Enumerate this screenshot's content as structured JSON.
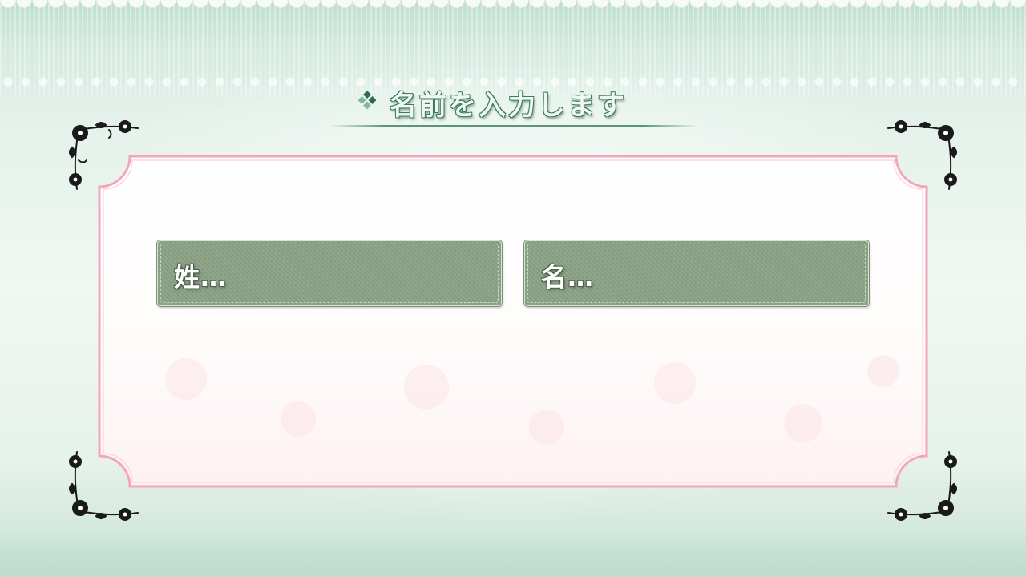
{
  "screen": {
    "title": "名前を入力します"
  },
  "fields": {
    "surname_label": "姓…",
    "given_name_label": "名…"
  },
  "colors": {
    "background": "#e4f1ea",
    "title_outline": "#3e7a5e",
    "panel_border": "#f2a7b8",
    "field_fill": "#8aa285"
  },
  "icons": {
    "title_marker": "diamond-cluster-icon",
    "corner_ornament": "rose-corner-ornament"
  }
}
